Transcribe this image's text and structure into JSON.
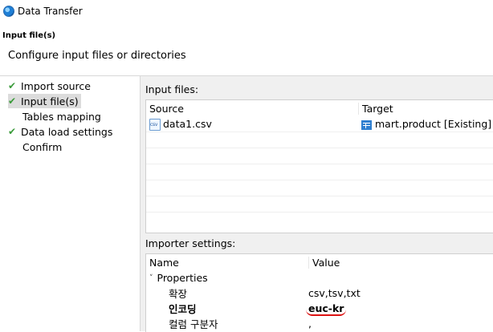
{
  "window": {
    "title": "Data Transfer"
  },
  "header": {
    "title": "Input file(s)",
    "description": "Configure input files or directories"
  },
  "sidebar": {
    "items": [
      {
        "label": "Import source",
        "checked": true,
        "selected": false
      },
      {
        "label": "Input file(s)",
        "checked": true,
        "selected": true
      },
      {
        "label": "Tables mapping",
        "checked": false,
        "selected": false
      },
      {
        "label": "Data load settings",
        "checked": true,
        "selected": false
      },
      {
        "label": "Confirm",
        "checked": false,
        "selected": false
      }
    ]
  },
  "input_files": {
    "label": "Input files:",
    "columns": [
      "Source",
      "Target"
    ],
    "rows": [
      {
        "source": "data1.csv",
        "target": "mart.product [Existing]"
      }
    ]
  },
  "importer_settings": {
    "label": "Importer settings:",
    "columns": [
      "Name",
      "Value"
    ],
    "group": "Properties",
    "properties": [
      {
        "name": "확장",
        "value": "csv,tsv,txt"
      },
      {
        "name": "인코딩",
        "value": "euc-kr"
      },
      {
        "name": "컬럼 구분자",
        "value": ","
      }
    ]
  },
  "colors": {
    "check": "#3a9b3a",
    "selection": "#dcdcdc",
    "panel_bg": "#f0f0f0",
    "annotation": "#dd1111"
  }
}
